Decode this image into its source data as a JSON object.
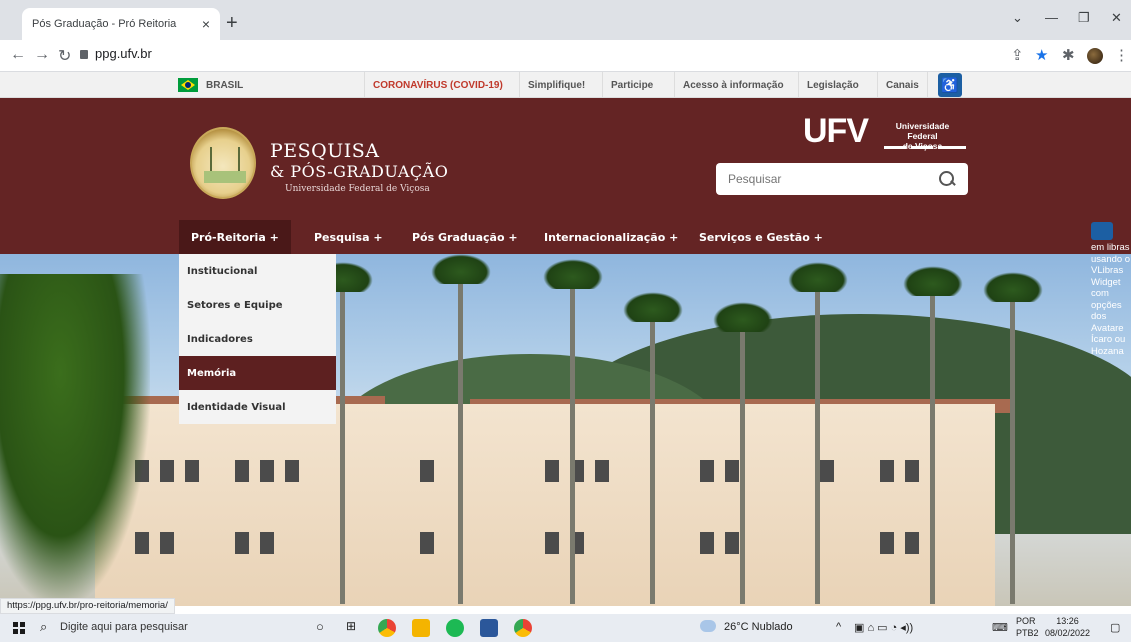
{
  "browser": {
    "tab_title": "Pós Graduação - Pró Reitoria",
    "tab_close": "×",
    "new_tab": "+",
    "url": "ppg.ufv.br",
    "status_url": "https://ppg.ufv.br/pro-reitoria/memoria/"
  },
  "govbar": {
    "brasil": "BRASIL",
    "links": [
      "CORONAVÍRUS (COVID-19)",
      "Simplifique!",
      "Participe",
      "Acesso à informação",
      "Legislação",
      "Canais"
    ]
  },
  "header": {
    "brand_line1": "PESQUISA",
    "brand_line2": "& PÓS-GRADUAÇÃO",
    "brand_line3": "Universidade Federal de Viçosa",
    "ufv": "UFV",
    "ufv_sub_line1": "Universidade Federal",
    "ufv_sub_line2": "de Viçosa",
    "search_placeholder": "Pesquisar"
  },
  "nav": {
    "items": [
      "Pró-Reitoria +",
      "Pesquisa +",
      "Pós Graduação +",
      "Internacionalização +",
      "Serviços e Gestão +"
    ],
    "dropdown": [
      "Institucional",
      "Setores e Equipe",
      "Indicadores",
      "Memória",
      "Identidade Visual"
    ]
  },
  "vlibras_alt": "Conteúdo acessível em libras usando o VLibras Widget com opções dos Avatares Ícaro ou Hozana",
  "vlibras_visible": "em libras usando o VLibras Widget com opções dos Avatare Ícaro ou Hozana",
  "taskbar": {
    "search_placeholder": "Digite aqui para pesquisar",
    "weather": "26°C  Nublado",
    "lang_1": "POR",
    "lang_2": "PTB2",
    "time": "13:26",
    "date": "08/02/2022"
  },
  "colors": {
    "header_bg": "#642424",
    "nav_active": "#4a1818",
    "dropdown_hl": "#5d2020",
    "covid_link": "#c0392b"
  },
  "icons": [
    "back-icon",
    "forward-icon",
    "reload-icon",
    "lock-icon",
    "share-icon",
    "star-icon",
    "extensions-icon",
    "profile-icon",
    "menu-icon",
    "accessibility-icon",
    "search-icon",
    "windows-icon"
  ]
}
